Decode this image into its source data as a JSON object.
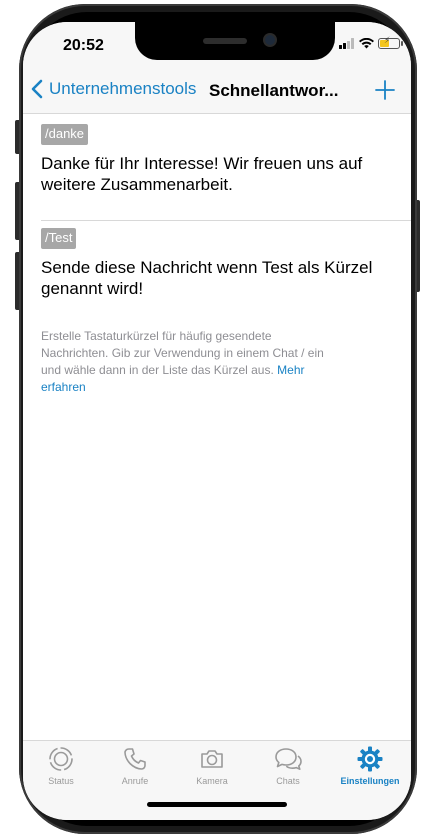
{
  "status_bar": {
    "time": "20:52"
  },
  "nav": {
    "back_label": "Unternehmenstools",
    "title": "Schnellantwor...",
    "add_icon": "plus-icon"
  },
  "replies": [
    {
      "shortcut": "/danke",
      "message": "Danke für Ihr Interesse! Wir freuen uns auf weitere Zusammenarbeit."
    },
    {
      "shortcut": "/Test",
      "message": "Sende diese Nachricht wenn Test als Kürzel genannt wird!"
    }
  ],
  "hint": {
    "text": "Erstelle Tastaturkürzel für häufig gesendete Nachrichten. Gib zur Verwendung in einem Chat / ein und wähle dann in der Liste das Kürzel aus.",
    "link": "Mehr erfahren"
  },
  "tabs": [
    {
      "label": "Status",
      "icon": "status-icon"
    },
    {
      "label": "Anrufe",
      "icon": "phone-icon"
    },
    {
      "label": "Kamera",
      "icon": "camera-icon"
    },
    {
      "label": "Chats",
      "icon": "chat-bubbles-icon"
    },
    {
      "label": "Einstellungen",
      "icon": "gear-icon",
      "active": true
    }
  ],
  "colors": {
    "accent": "#1a82c4",
    "shortcut_badge": "#a7a7a7",
    "battery_charging": "#f4c51b"
  }
}
